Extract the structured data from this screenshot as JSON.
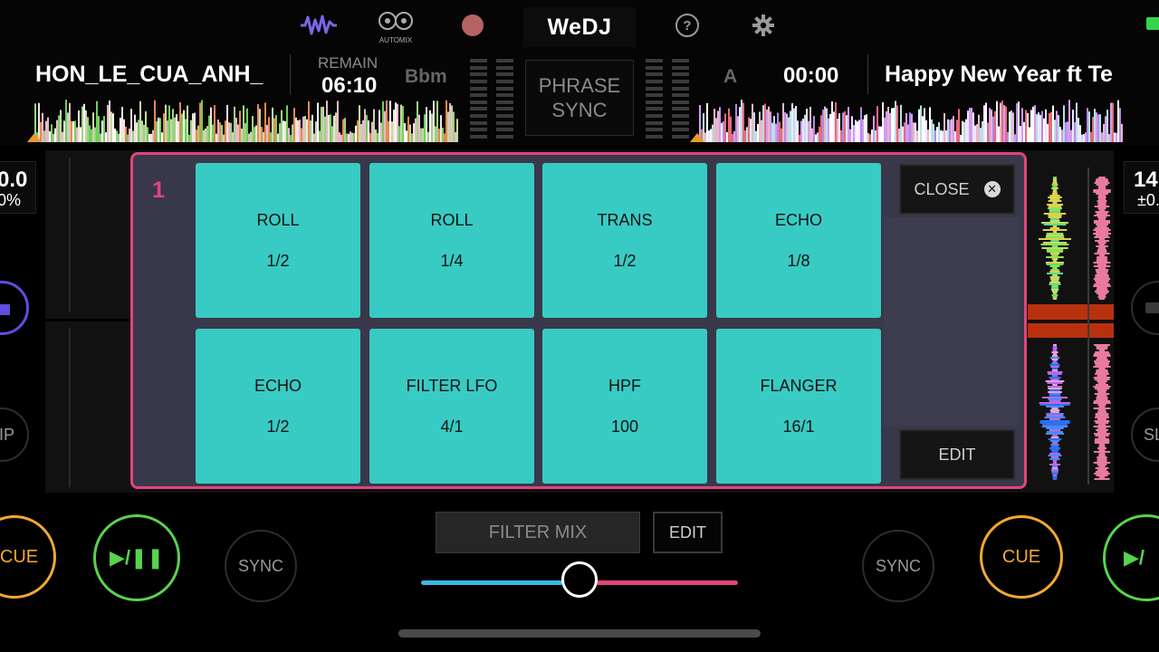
{
  "top": {
    "logo": "WeDJ",
    "automix_label": "AUTOMIX",
    "help_icon": "?"
  },
  "deck_left": {
    "title": "HON_LE_CUA_ANH_",
    "remain_label": "REMAIN",
    "remain_time": "06:10",
    "key": "Bbm",
    "pitch": "0.0",
    "pitch_pct": "0%",
    "side_label": "IP",
    "cue": "CUE",
    "play": "▶/❚❚",
    "sync": "SYNC"
  },
  "deck_right": {
    "key": "A",
    "time": "00:00",
    "title": "Happy New Year ft Te",
    "pitch": "14",
    "pitch_pct": "±0.",
    "side_label": "SL",
    "cue": "CUE",
    "play": "▶/",
    "sync": "SYNC"
  },
  "phrase_sync": {
    "line1": "PHRASE",
    "line2": "SYNC"
  },
  "fx_panel": {
    "page": "1",
    "close_label": "CLOSE",
    "edit_label": "EDIT",
    "pads": [
      {
        "name": "ROLL",
        "value": "1/2"
      },
      {
        "name": "ROLL",
        "value": "1/4"
      },
      {
        "name": "TRANS",
        "value": "1/2"
      },
      {
        "name": "ECHO",
        "value": "1/8"
      },
      {
        "name": "ECHO",
        "value": "1/2"
      },
      {
        "name": "FILTER LFO",
        "value": "4/1"
      },
      {
        "name": "HPF",
        "value": "100"
      },
      {
        "name": "FLANGER",
        "value": "16/1"
      }
    ]
  },
  "mixer": {
    "filter_mix_label": "FILTER MIX",
    "edit_label": "EDIT",
    "crossfader_position": 0.5
  },
  "colors": {
    "accent_pink": "#e0447e",
    "pad_teal": "#38cbc4",
    "cue_orange": "#f0a932",
    "play_green": "#59d24d",
    "fader_left": "#36b8e6",
    "fader_right": "#e0447e"
  }
}
